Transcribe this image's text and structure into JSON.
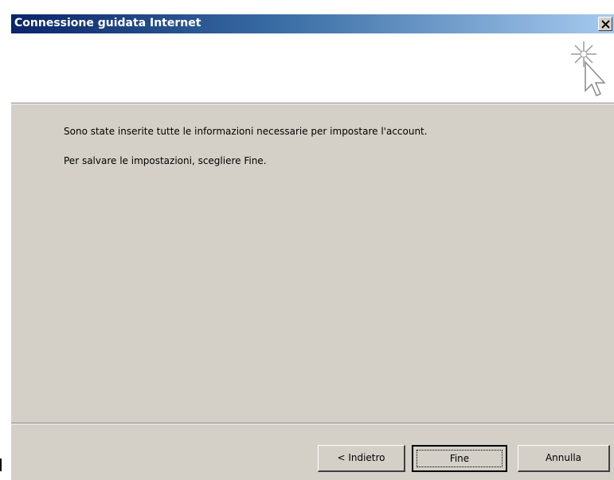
{
  "window": {
    "title": "Connessione guidata Internet",
    "close_glyph": "×"
  },
  "header": {
    "icon": "wizard-star-cursor-icon"
  },
  "content": {
    "line1": "Sono state inserite tutte le informazioni necessarie per impostare l'account.",
    "line2": "Per salvare le impostazioni, scegliere Fine."
  },
  "buttons": {
    "back_label": "< Indietro",
    "finish_label": "Fine",
    "cancel_label": "Annulla"
  },
  "colors": {
    "title_start": "#0a246a",
    "title_end": "#a6caf0",
    "face": "#d4d0c8"
  }
}
